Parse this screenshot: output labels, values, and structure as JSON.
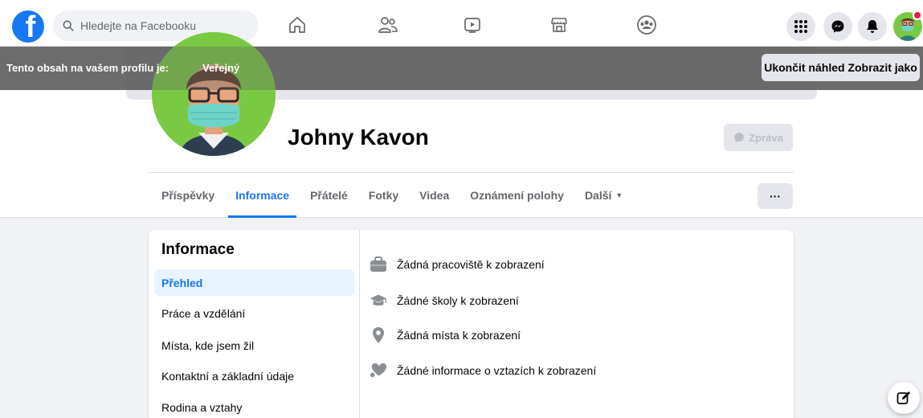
{
  "topbar": {
    "logo_letter": "f",
    "search_placeholder": "Hledejte na Facebooku",
    "nav_icons": [
      "home-icon",
      "friends-icon",
      "watch-icon",
      "marketplace-icon",
      "groups-icon"
    ],
    "right_icons": [
      "menu-grid-icon",
      "messenger-icon",
      "notifications-icon"
    ]
  },
  "banner": {
    "text": "Tento obsah na vašem profilu je:",
    "visibility": "Veřejný",
    "exit_label": "Ukončit náhled Zobrazit jako"
  },
  "profile": {
    "name": "Johny Kavon",
    "message_label": "Zpráva"
  },
  "tabs": [
    {
      "label": "Příspěvky",
      "active": false
    },
    {
      "label": "Informace",
      "active": true
    },
    {
      "label": "Přátelé",
      "active": false
    },
    {
      "label": "Fotky",
      "active": false
    },
    {
      "label": "Videa",
      "active": false
    },
    {
      "label": "Oznámení polohy",
      "active": false
    },
    {
      "label": "Další",
      "active": false
    }
  ],
  "more_label": "···",
  "about": {
    "title": "Informace",
    "side_items": [
      {
        "label": "Přehled",
        "active": true
      },
      {
        "label": "Práce a vzdělání",
        "active": false
      },
      {
        "label": "Místa, kde jsem žil",
        "active": false
      },
      {
        "label": "Kontaktní a základní údaje",
        "active": false
      },
      {
        "label": "Rodina a vztahy",
        "active": false
      }
    ],
    "rows": [
      {
        "icon": "briefcase-icon",
        "text": "Žádná pracoviště k zobrazení"
      },
      {
        "icon": "graduation-cap-icon",
        "text": "Žádné školy k zobrazení"
      },
      {
        "icon": "location-pin-icon",
        "text": "Žádná místa k zobrazení"
      },
      {
        "icon": "heart-icon",
        "text": "Žádné informace o vztazích k zobrazení"
      }
    ]
  },
  "colors": {
    "brand": "#1877f2",
    "notification": "#e41e3f",
    "avatar_bg": "#7ac943"
  }
}
